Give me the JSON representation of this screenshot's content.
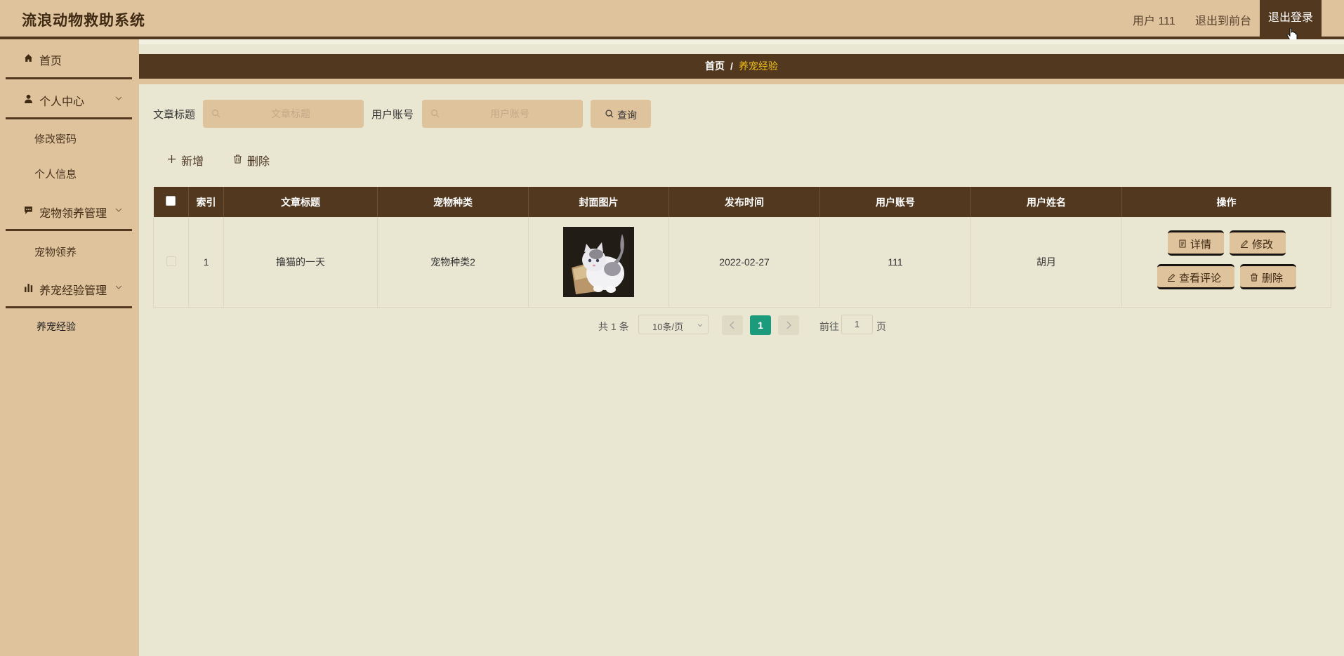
{
  "app": {
    "title": "流浪动物救助系统",
    "user_label": "用户 111",
    "front_link": "退出到前台",
    "logout": "退出登录"
  },
  "sidebar": {
    "home": "首页",
    "personal_center": "个人中心",
    "change_password": "修改密码",
    "personal_info": "个人信息",
    "adoption_mgmt": "宠物领养管理",
    "pet_adoption": "宠物领养",
    "experience_mgmt": "养宠经验管理",
    "pet_experience": "养宠经验"
  },
  "breadcrumb": {
    "home": "首页",
    "separator": "/",
    "current": "养宠经验"
  },
  "search": {
    "title_label": "文章标题",
    "title_placeholder": "文章标题",
    "account_label": "用户账号",
    "account_placeholder": "用户账号",
    "query_button": "查询"
  },
  "actions": {
    "add": "新增",
    "delete": "删除"
  },
  "table": {
    "headers": [
      "索引",
      "文章标题",
      "宠物种类",
      "封面图片",
      "发布时间",
      "用户账号",
      "用户姓名",
      "操作"
    ],
    "rows": [
      {
        "index": "1",
        "title": "撸猫的一天",
        "pet_type": "宠物种类2",
        "publish_time": "2022-02-27",
        "account": "111",
        "name": "胡月",
        "ops": {
          "detail": "详情",
          "edit": "修改",
          "comments": "查看评论",
          "delete": "删除"
        }
      }
    ]
  },
  "pagination": {
    "total": "共 1 条",
    "page_size": "10条/页",
    "current_page": "1",
    "goto_label": "前往",
    "goto_value": "1",
    "page_unit": "页"
  },
  "colors": {
    "header_bg": "#dfc39c",
    "dark_brown": "#51381f",
    "content_bg": "#e9e6d2",
    "page_active": "#1b9a7c",
    "breadcrumb_current": "#f0c11a"
  }
}
